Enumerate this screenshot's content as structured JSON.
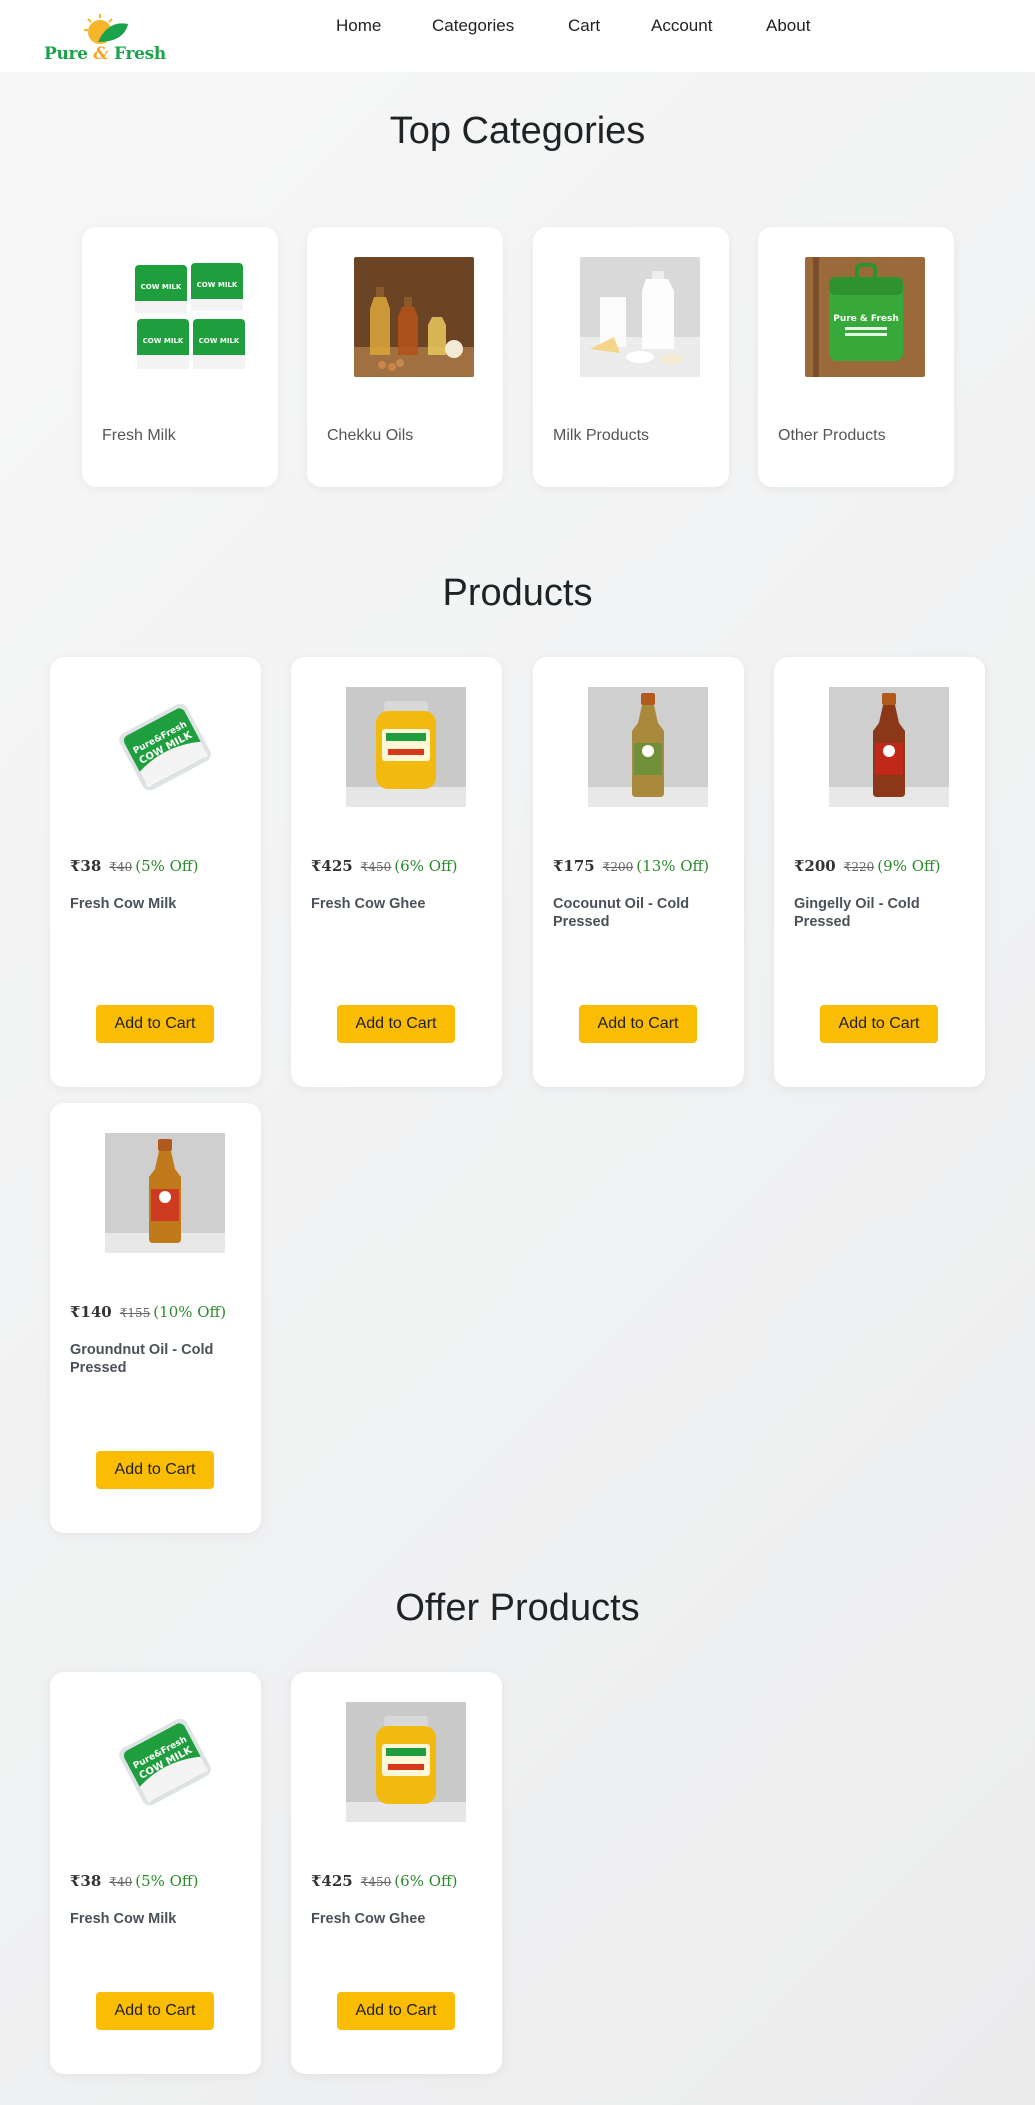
{
  "brand": {
    "logo_text_1": "Pure",
    "logo_amp": "&",
    "logo_text_2": "Fresh"
  },
  "nav": [
    "Home",
    "Categories",
    "Cart",
    "Account",
    "About"
  ],
  "top_categories": {
    "title": "Top Categories",
    "items": [
      {
        "label": "Fresh Milk",
        "icon": "milk-packets-image"
      },
      {
        "label": "Chekku Oils",
        "icon": "oil-bottles-image"
      },
      {
        "label": "Milk Products",
        "icon": "dairy-products-image"
      },
      {
        "label": "Other Products",
        "icon": "green-bag-image"
      }
    ]
  },
  "products": {
    "title": "Products",
    "items": [
      {
        "price": "₹38",
        "old_price": "₹40",
        "off": "(5% Off)",
        "name": "Fresh Cow Milk",
        "icon": "milk-packet-image"
      },
      {
        "price": "₹425",
        "old_price": "₹450",
        "off": "(6% Off)",
        "name": "Fresh Cow Ghee",
        "icon": "ghee-jar-image"
      },
      {
        "price": "₹175",
        "old_price": "₹200",
        "off": "(13% Off)",
        "name": "Cocounut Oil - Cold Pressed",
        "icon": "coconut-oil-bottle-image"
      },
      {
        "price": "₹200",
        "old_price": "₹220",
        "off": "(9% Off)",
        "name": "Gingelly Oil - Cold Pressed",
        "icon": "gingelly-oil-bottle-image"
      },
      {
        "price": "₹140",
        "old_price": "₹155",
        "off": "(10% Off)",
        "name": "Groundnut Oil - Cold Pressed",
        "icon": "groundnut-oil-bottle-image"
      }
    ]
  },
  "offer_products": {
    "title": "Offer Products",
    "items": [
      {
        "price": "₹38",
        "old_price": "₹40",
        "off": "(5% Off)",
        "name": "Fresh Cow Milk",
        "icon": "milk-packet-image"
      },
      {
        "price": "₹425",
        "old_price": "₹450",
        "off": "(6% Off)",
        "name": "Fresh Cow Ghee",
        "icon": "ghee-jar-image"
      }
    ]
  },
  "add_to_cart_label": "Add to Cart",
  "colors": {
    "accent": "#fbbc04",
    "brand_green": "#1aa34a",
    "discount": "#2a8a2a"
  }
}
